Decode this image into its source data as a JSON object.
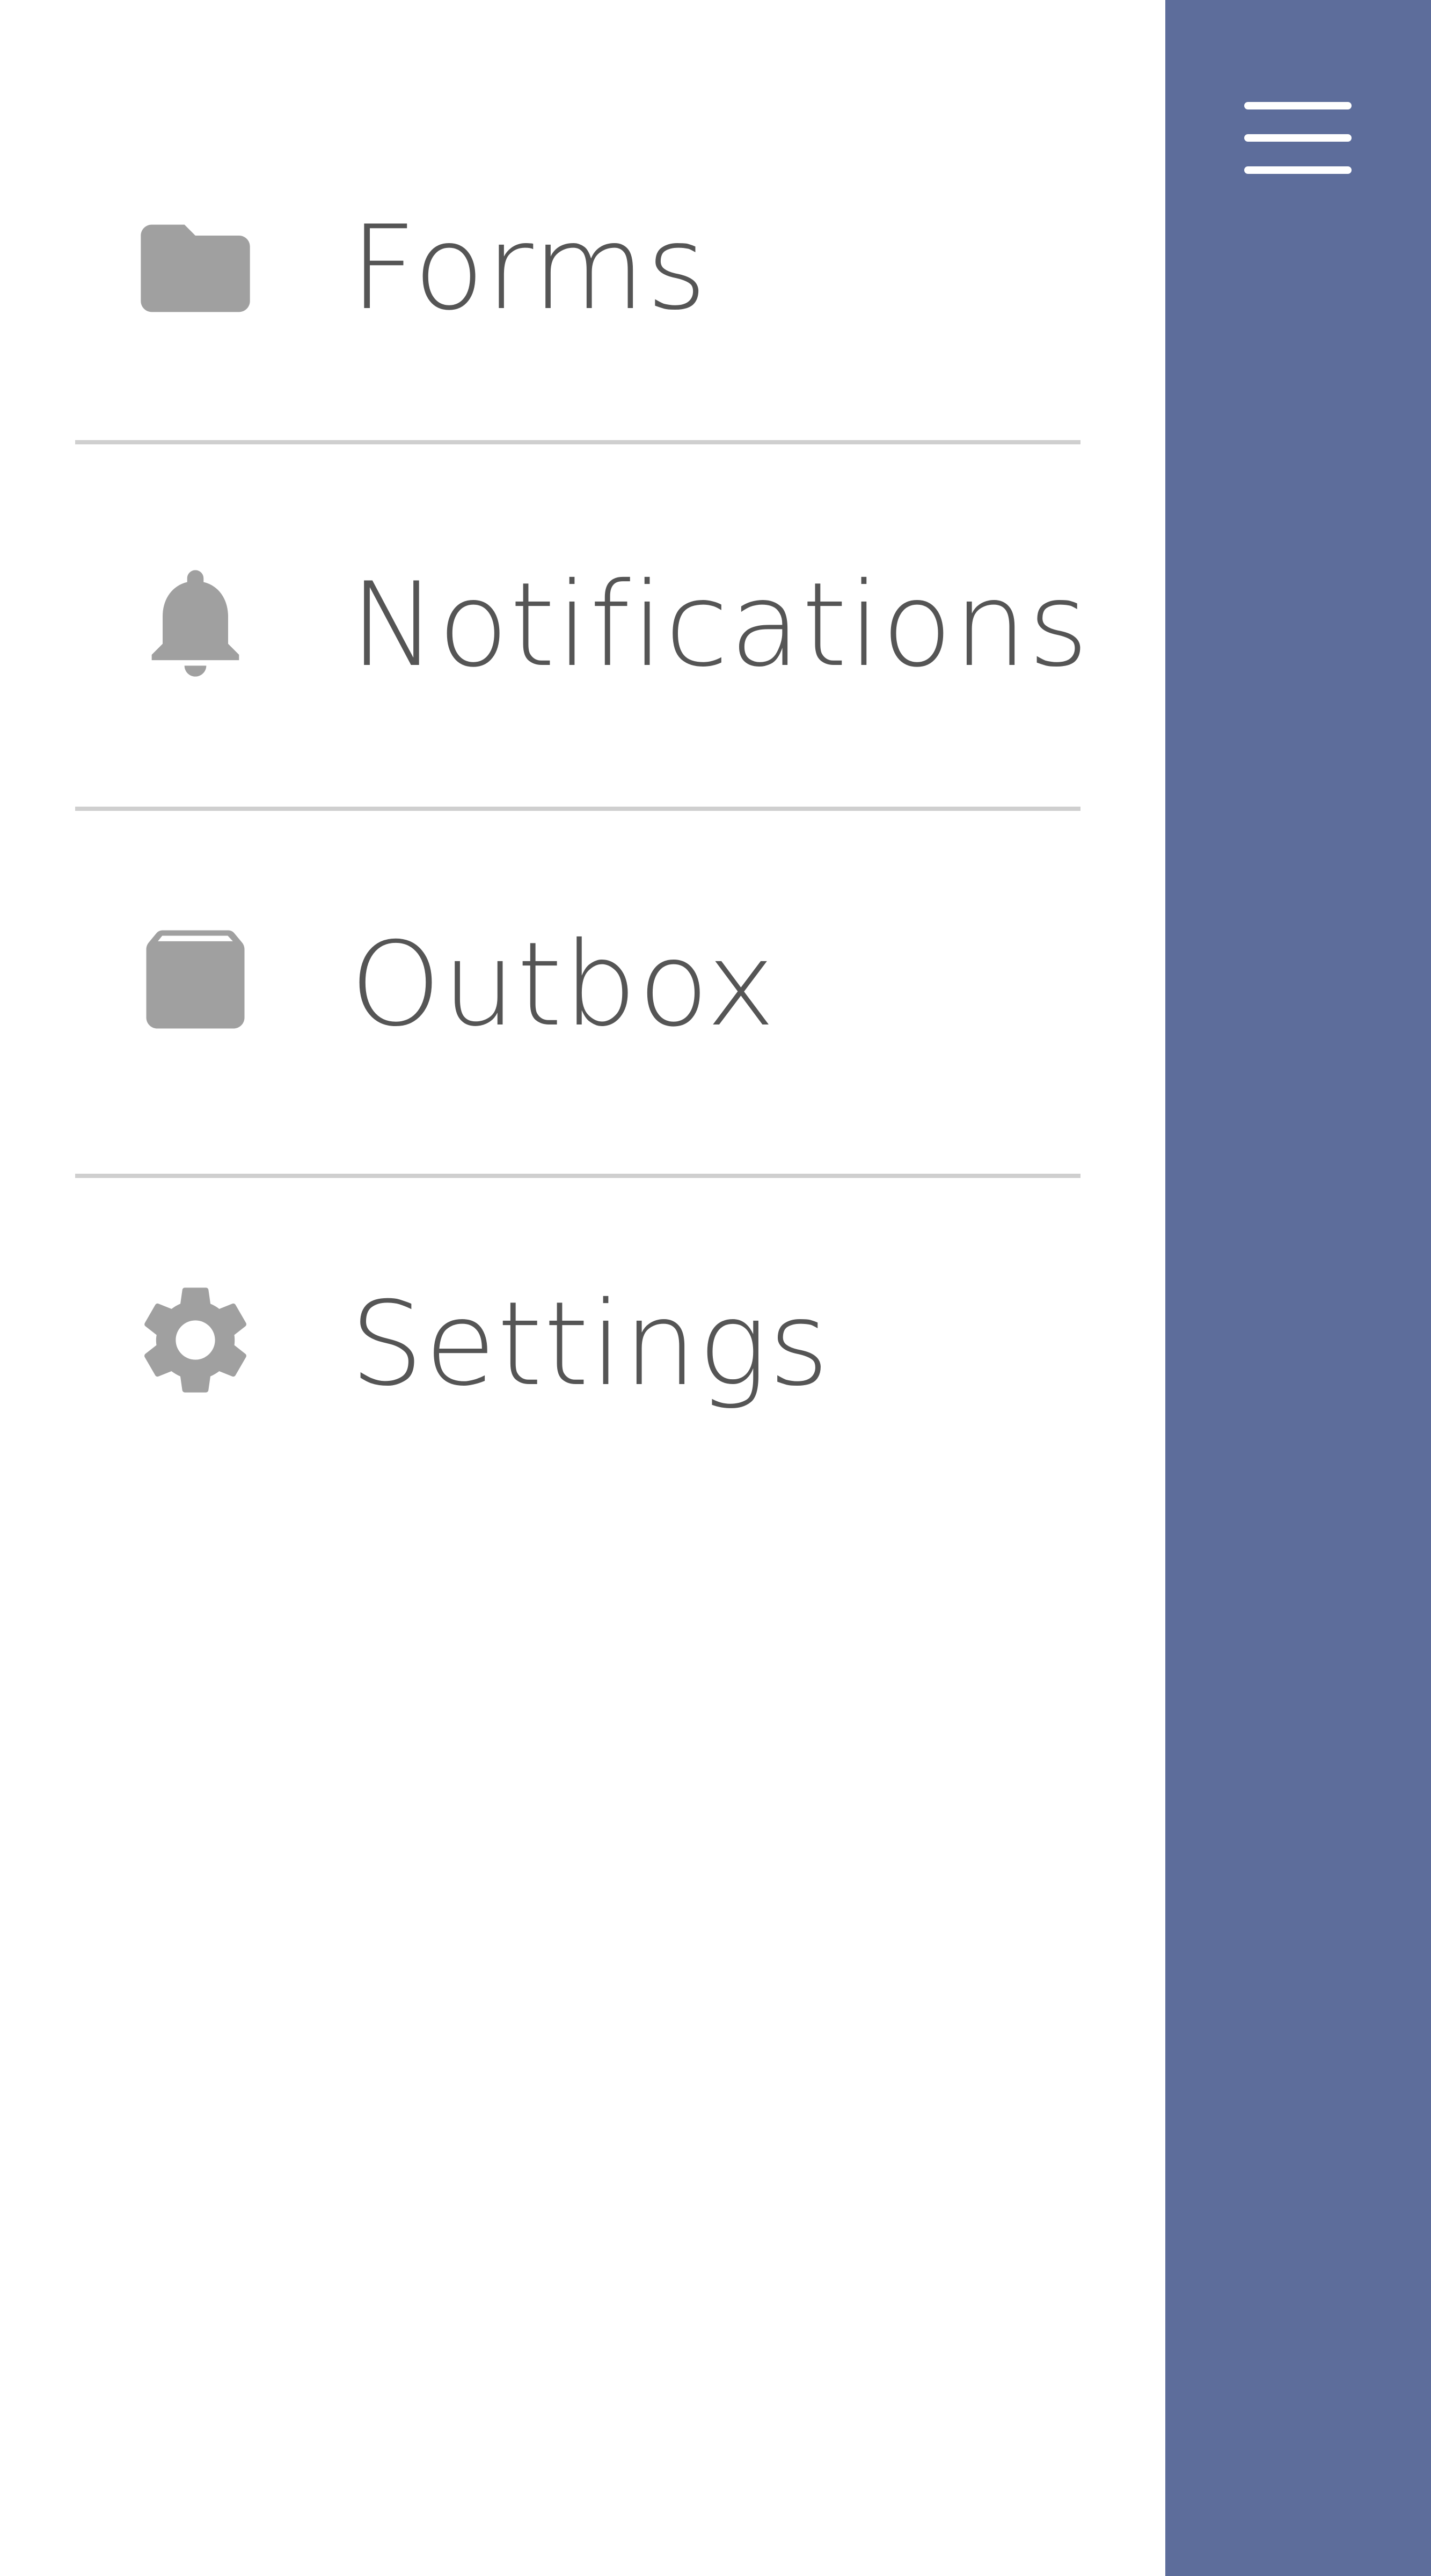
{
  "drawer": {
    "items": [
      {
        "label": "Forms",
        "icon": "folder-icon"
      },
      {
        "label": "Notifications",
        "icon": "bell-icon"
      },
      {
        "label": "Outbox",
        "icon": "archive-box-icon"
      },
      {
        "label": "Settings",
        "icon": "gear-icon"
      }
    ]
  },
  "side_panel": {
    "icon": "hamburger-menu-icon"
  },
  "colors": {
    "side_panel_bg": "#5d6d9b",
    "icon_gray": "#a0a0a0",
    "label_text": "#555555",
    "divider": "#cfcfcf",
    "background": "#ffffff"
  }
}
